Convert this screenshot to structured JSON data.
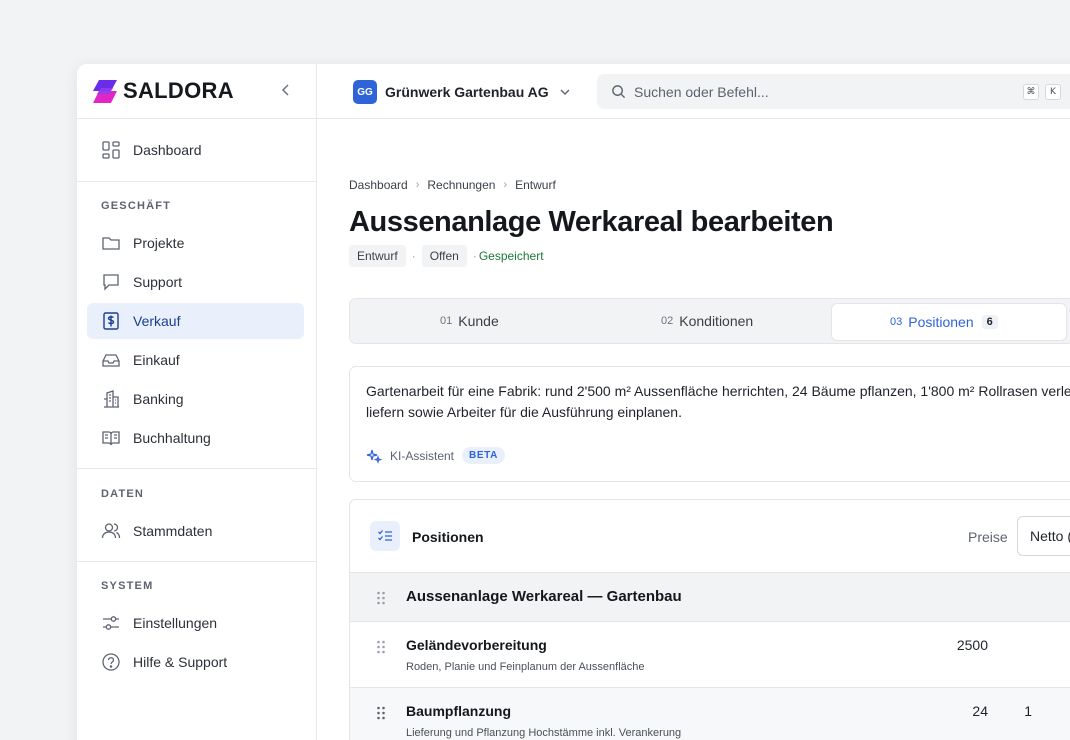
{
  "app": {
    "name": "SALDORA"
  },
  "sidebar": {
    "dashboard": "Dashboard",
    "sections": {
      "business": "GESCHÄFT",
      "data": "DATEN",
      "system": "SYSTEM"
    },
    "items": [
      {
        "label": "Projekte",
        "icon": "folder-icon"
      },
      {
        "label": "Support",
        "icon": "chat-icon"
      },
      {
        "label": "Verkauf",
        "icon": "dollar-document-icon",
        "active": true
      },
      {
        "label": "Einkauf",
        "icon": "inbox-icon"
      },
      {
        "label": "Banking",
        "icon": "bank-icon"
      },
      {
        "label": "Buchhaltung",
        "icon": "ledger-book-icon"
      },
      {
        "label": "Stammdaten",
        "icon": "users-icon"
      },
      {
        "label": "Einstellungen",
        "icon": "sliders-icon"
      },
      {
        "label": "Hilfe & Support",
        "icon": "help-circle-icon"
      }
    ]
  },
  "topbar": {
    "company_initials": "GG",
    "company_name": "Grünwerk Gartenbau AG",
    "search_placeholder": "Suchen oder Befehl...",
    "shortcut_key1": "⌘",
    "shortcut_key2": "K"
  },
  "breadcrumbs": [
    "Dashboard",
    "Rechnungen",
    "Entwurf"
  ],
  "page": {
    "title": "Aussenanlage Werkareal bearbeiten",
    "status_badge": "Entwurf",
    "state_badge": "Offen",
    "saved": "Gespeichert"
  },
  "steps": [
    {
      "num": "01",
      "label": "Kunde"
    },
    {
      "num": "02",
      "label": "Konditionen"
    },
    {
      "num": "03",
      "label": "Positionen",
      "count": "6",
      "active": true
    }
  ],
  "ai": {
    "prompt_line1": "Gartenarbeit für eine Fabrik: rund 2'500 m² Aussenfläche herrichten, 24 Bäume pflanzen, 1'800 m² Rollrasen verle",
    "prompt_line2": "liefern sowie Arbeiter für die Ausführung einplanen.",
    "assistant_label": "KI-Assistent",
    "beta_label": "BETA"
  },
  "positions": {
    "title": "Positionen",
    "price_label": "Preise",
    "price_mode": "Netto (",
    "group_title": "Aussenanlage Werkareal — Gartenbau",
    "rows": [
      {
        "name": "Geländevorbereitung",
        "desc": "Roden, Planie und Feinplanum der Aussenfläche",
        "qty": "2500",
        "extra": ""
      },
      {
        "name": "Baumpflanzung",
        "desc": "Lieferung und Pflanzung Hochstämme inkl. Verankerung",
        "qty": "24",
        "extra": "1"
      }
    ]
  },
  "colors": {
    "accent": "#2e64d8",
    "saved": "#1c7a35",
    "logo_pink": "#e026c6",
    "logo_violet": "#6a2ce8"
  }
}
